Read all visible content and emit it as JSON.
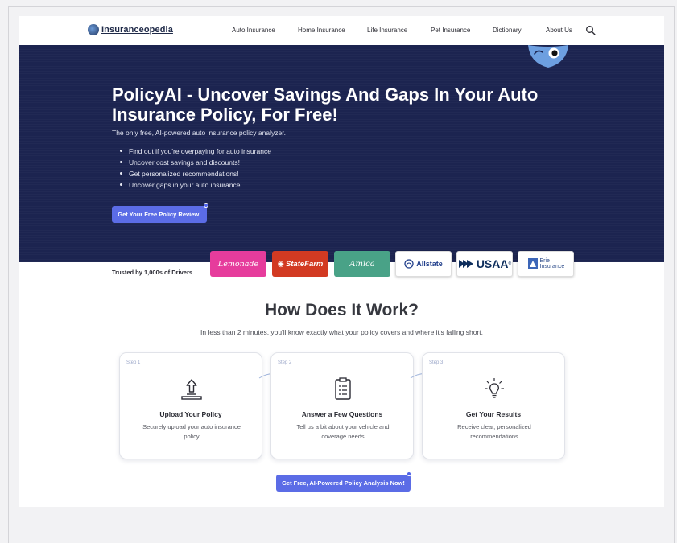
{
  "nav": {
    "logo": "Insuranceopedia",
    "links": [
      "Auto Insurance",
      "Home Insurance",
      "Life Insurance",
      "Pet Insurance",
      "Dictionary",
      "About Us"
    ]
  },
  "hero": {
    "title": "PolicyAI - Uncover Savings And Gaps In Your Auto Insurance Policy, For Free!",
    "subtitle": "The only free, AI-powered auto insurance policy analyzer.",
    "bullets": [
      "Find out if you're overpaying for auto insurance",
      "Uncover cost savings and discounts!",
      "Get personalized recommendations!",
      "Uncover gaps in your auto insurance"
    ],
    "cta": "Get Your Free Policy Review!"
  },
  "trusted": {
    "label": "Trusted by 1,000s of Drivers",
    "brands": [
      "Lemonade",
      "StateFarm",
      "Amica",
      "Allstate",
      "USAA",
      "Erie Insurance"
    ]
  },
  "how": {
    "title": "How Does It Work?",
    "subtitle": "In less than 2 minutes, you'll know exactly what your policy covers and where it's falling short.",
    "steps": [
      {
        "num": "Step 1",
        "title": "Upload Your Policy",
        "desc": "Securely upload your auto insurance policy",
        "icon": "upload-icon"
      },
      {
        "num": "Step 2",
        "title": "Answer a Few Questions",
        "desc": "Tell us a bit about your vehicle and coverage needs",
        "icon": "clipboard-icon"
      },
      {
        "num": "Step 3",
        "title": "Get Your Results",
        "desc": "Receive clear, personalized recommendations",
        "icon": "lightbulb-icon"
      }
    ],
    "cta": "Get Free, AI-Powered Policy Analysis Now!"
  },
  "colors": {
    "hero_bg": "#1c2450",
    "accent": "#5b6ce6"
  }
}
